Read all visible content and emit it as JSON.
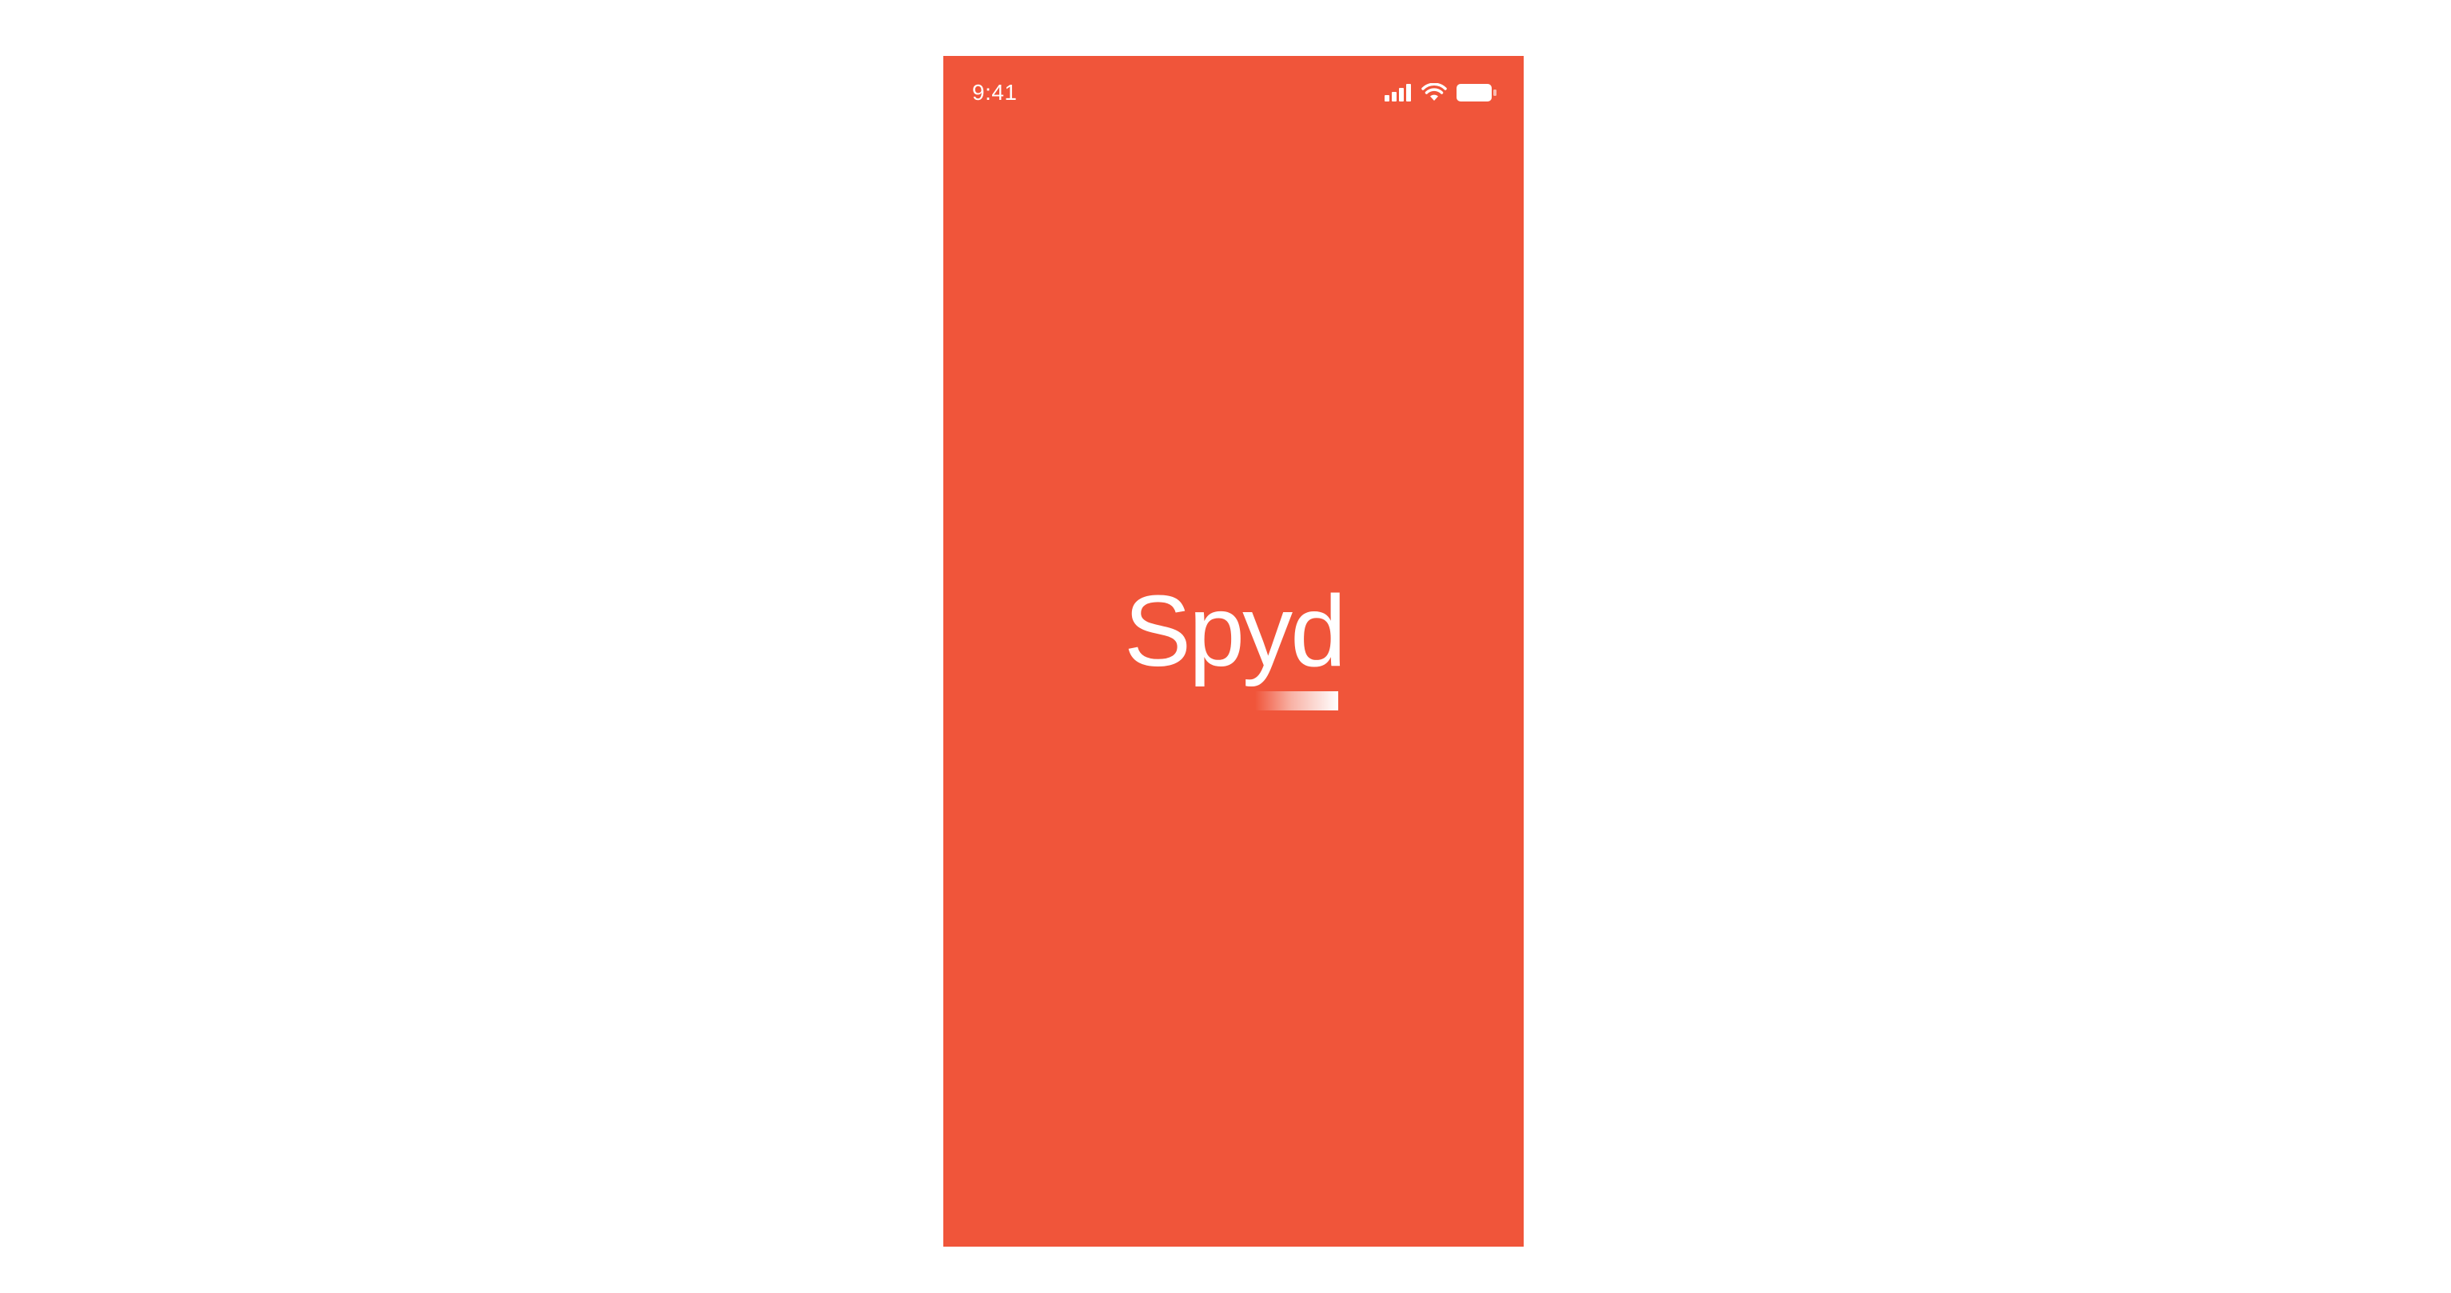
{
  "status_bar": {
    "time": "9:41",
    "icons": [
      "cellular-signal-icon",
      "wifi-icon",
      "battery-icon"
    ]
  },
  "splash": {
    "logo_text": "Spyd",
    "loading_progress": 0.55
  },
  "colors": {
    "background": "#F0553A",
    "foreground": "#FFFFFF",
    "page": "#FFFFFF"
  }
}
